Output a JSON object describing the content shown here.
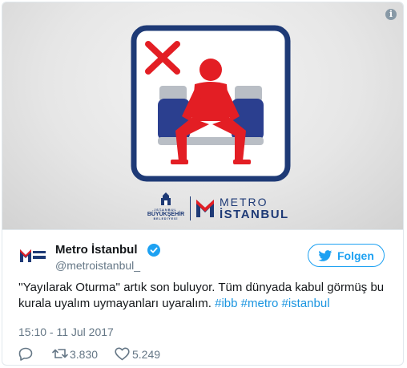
{
  "media": {
    "sign_icon": "no-manspreading-sign-icon",
    "logo_left_lines": [
      "İSTANBUL",
      "BÜYÜKŞEHİR",
      "BELEDİYESİ"
    ],
    "logo_right_line1": "METRO",
    "logo_right_line2": "İSTANBUL",
    "colors": {
      "navy": "#1e3a76",
      "red": "#e31e24",
      "seat_blue": "#2b3f8f",
      "seat_grey": "#b9bec5"
    }
  },
  "tweet": {
    "author_name": "Metro İstanbul",
    "handle": "@metroistanbul_",
    "follow_label": "Folgen",
    "text_main": "''Yayılarak Oturma'' artık son buluyor. Tüm dünyada kabul görmüş bu kurala uyalım uymayanları uyaralım.",
    "hashtags": [
      "#ibb",
      "#metro",
      "#istanbul"
    ],
    "timestamp": "15:10 - 11 Jul 2017",
    "retweets": "3.830",
    "likes": "5.249",
    "colors": {
      "link": "#1b95e0",
      "follow": "#1da1f2",
      "muted": "#657786"
    }
  }
}
